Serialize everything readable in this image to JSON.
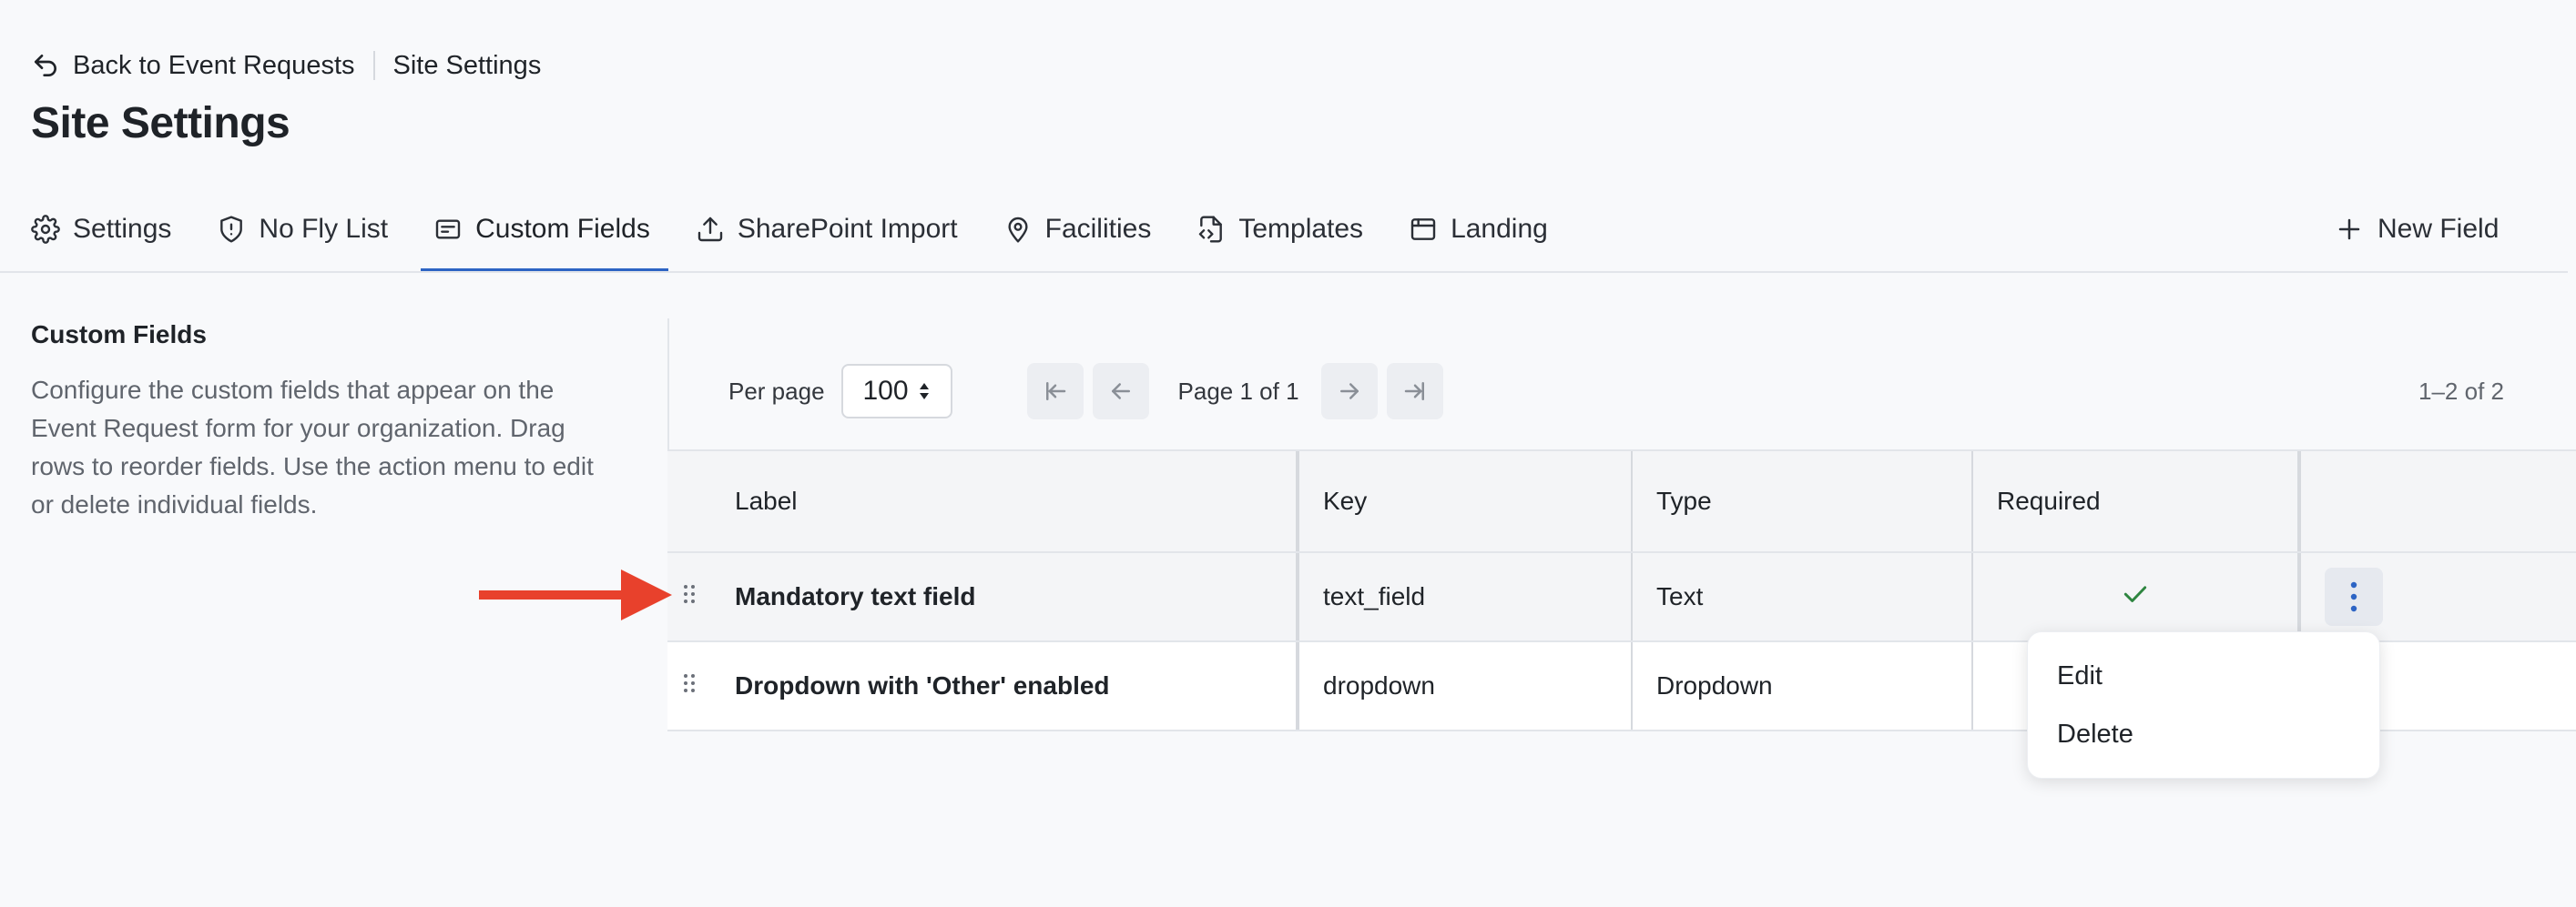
{
  "breadcrumb": {
    "back_label": "Back to Event Requests",
    "current": "Site Settings"
  },
  "page_title": "Site Settings",
  "tabs": [
    {
      "label": "Settings",
      "icon": "gear-icon"
    },
    {
      "label": "No Fly List",
      "icon": "shield-alert-icon"
    },
    {
      "label": "Custom Fields",
      "icon": "form-icon",
      "active": true
    },
    {
      "label": "SharePoint Import",
      "icon": "upload-icon"
    },
    {
      "label": "Facilities",
      "icon": "map-pin-icon"
    },
    {
      "label": "Templates",
      "icon": "file-code-icon"
    },
    {
      "label": "Landing",
      "icon": "browser-icon"
    }
  ],
  "new_field_label": "New Field",
  "section": {
    "title": "Custom Fields",
    "description": "Configure the custom fields that appear on the Event Request form for your organization. Drag rows to reorder fields. Use the action menu to edit or delete individual fields."
  },
  "pager": {
    "per_page_label": "Per page",
    "per_page_value": "100",
    "page_text": "Page 1 of 1",
    "count_text": "1–2 of 2"
  },
  "table": {
    "columns": [
      "Label",
      "Key",
      "Type",
      "Required",
      ""
    ],
    "rows": [
      {
        "label": "Mandatory text field",
        "key": "text_field",
        "type": "Text",
        "required": true
      },
      {
        "label": "Dropdown with 'Other' enabled",
        "key": "dropdown",
        "type": "Dropdown",
        "required": false
      }
    ]
  },
  "action_menu": {
    "items": [
      "Edit",
      "Delete"
    ]
  },
  "colors": {
    "accent": "#2d64c4",
    "arrow": "#e8412c",
    "check": "#2e8540"
  }
}
